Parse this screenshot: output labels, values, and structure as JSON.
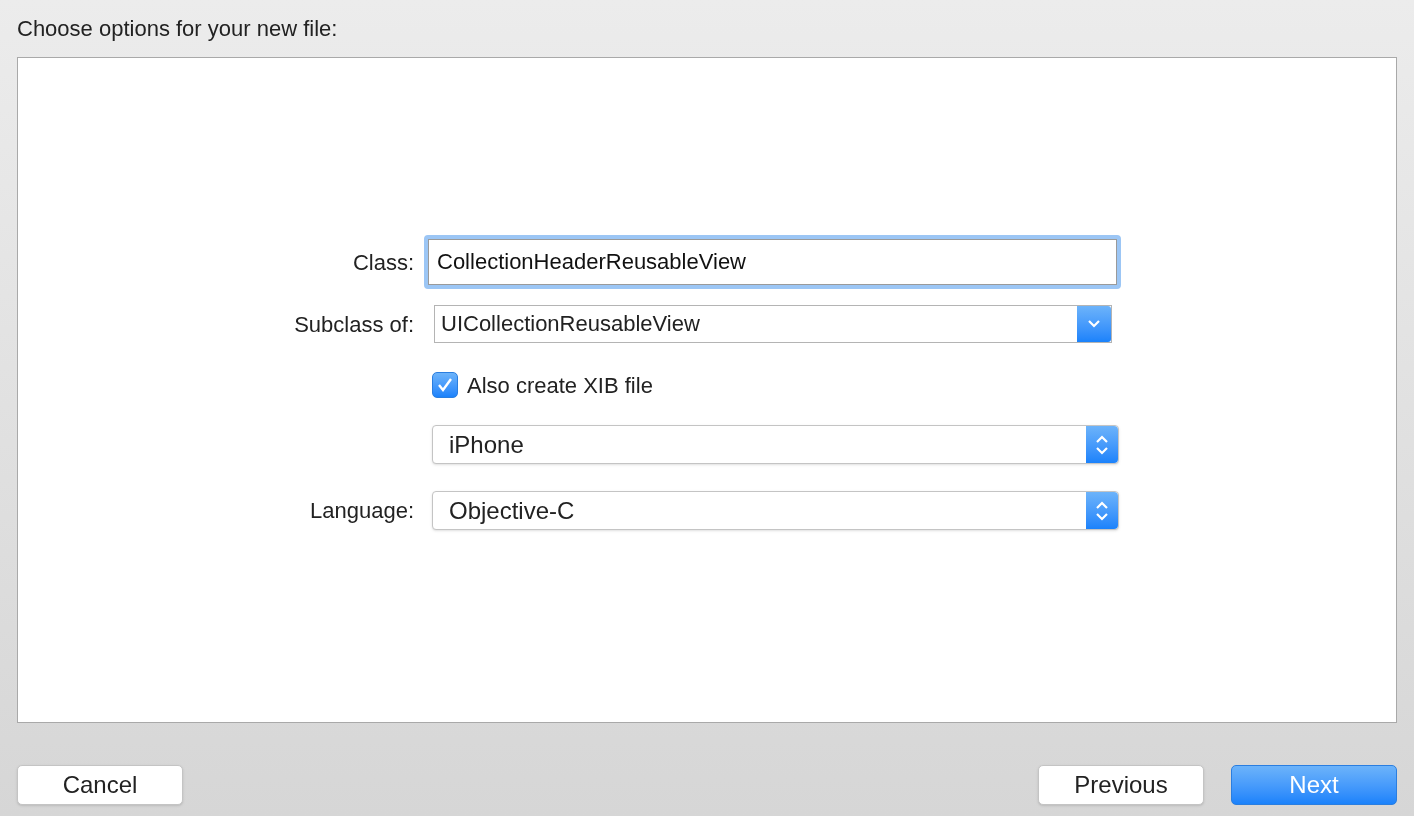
{
  "title": "Choose options for your new file:",
  "form": [
    {
      "kind": "text",
      "label": "Class:",
      "value": "CollectionHeaderReusableView",
      "focused": true
    },
    {
      "kind": "combo",
      "label": "Subclass of:",
      "value": "UICollectionReusableView"
    },
    {
      "kind": "checkbox",
      "text": "Also create XIB file",
      "checked": true
    },
    {
      "kind": "popup",
      "value": "iPhone"
    },
    {
      "kind": "popup",
      "label": "Language:",
      "value": "Objective-C"
    }
  ],
  "left_buttons": [
    {
      "label": "Cancel",
      "default": false
    }
  ],
  "right_buttons": [
    {
      "label": "Previous",
      "default": false
    },
    {
      "label": "Next",
      "default": true
    }
  ]
}
